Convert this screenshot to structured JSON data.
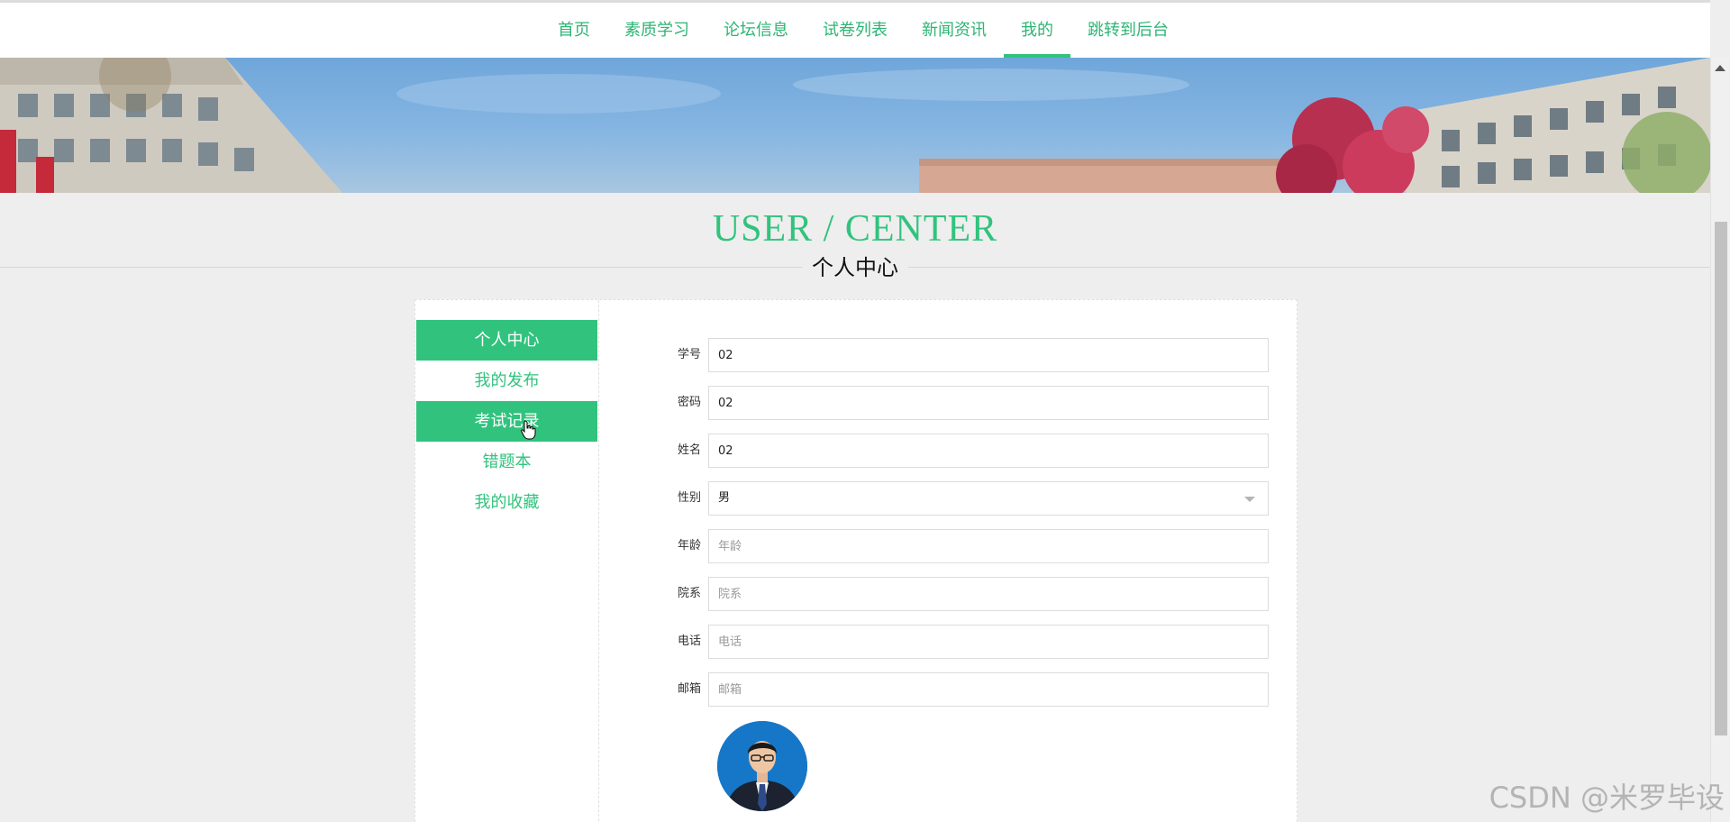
{
  "nav": {
    "items": [
      {
        "label": "首页"
      },
      {
        "label": "素质学习"
      },
      {
        "label": "论坛信息"
      },
      {
        "label": "试卷列表"
      },
      {
        "label": "新闻资讯"
      },
      {
        "label": "我的"
      },
      {
        "label": "跳转到后台"
      }
    ],
    "active_index": 5
  },
  "heading": {
    "en": "USER / CENTER",
    "cn": "个人中心"
  },
  "sidebar": {
    "items": [
      {
        "label": "个人中心",
        "active": true
      },
      {
        "label": "我的发布",
        "active": false
      },
      {
        "label": "考试记录",
        "active": true
      },
      {
        "label": "错题本",
        "active": false
      },
      {
        "label": "我的收藏",
        "active": false
      }
    ]
  },
  "form": {
    "student_id": {
      "label": "学号",
      "value": "02"
    },
    "password": {
      "label": "密码",
      "value": "02"
    },
    "name": {
      "label": "姓名",
      "value": "02"
    },
    "gender": {
      "label": "性别",
      "value": "男"
    },
    "age": {
      "label": "年龄",
      "placeholder": "年龄"
    },
    "department": {
      "label": "院系",
      "placeholder": "院系"
    },
    "phone": {
      "label": "电话",
      "placeholder": "电话"
    },
    "email": {
      "label": "邮箱",
      "placeholder": "邮箱"
    }
  },
  "watermark": "CSDN @米罗毕设",
  "colors": {
    "accent": "#31c37e",
    "nav_text": "#2db574",
    "page_bg": "#eeeeee"
  }
}
